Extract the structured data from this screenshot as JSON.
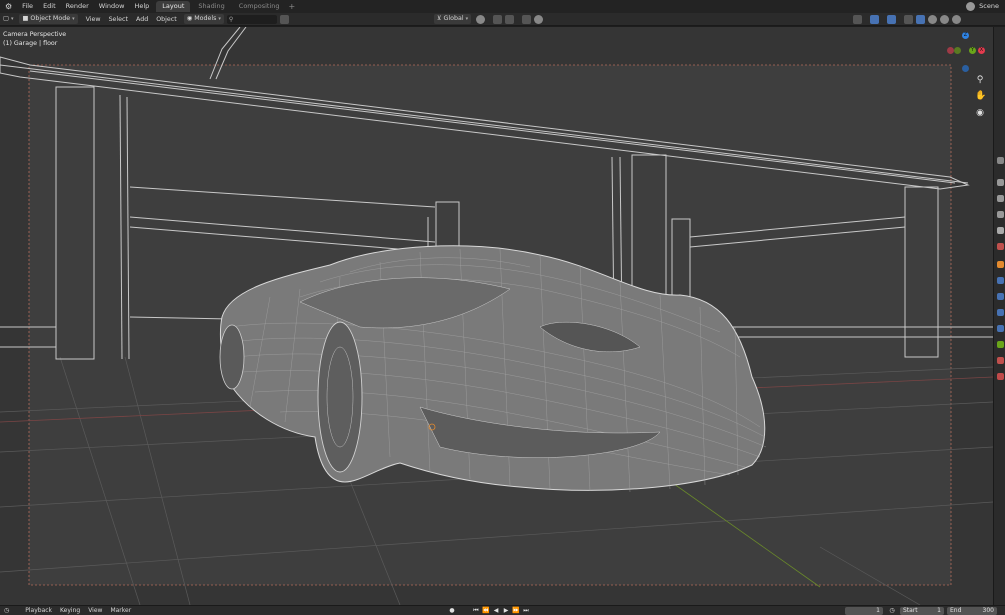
{
  "topbar": {
    "menus": [
      "File",
      "Edit",
      "Render",
      "Window",
      "Help"
    ],
    "workspace_tabs": [
      {
        "label": "Layout",
        "active": true
      },
      {
        "label": "Shading",
        "active": false
      },
      {
        "label": "Compositing",
        "active": false
      }
    ],
    "scene_label": "Scene"
  },
  "header": {
    "mode": "Object Mode",
    "menus": [
      "View",
      "Select",
      "Add",
      "Object"
    ],
    "collection": "Models",
    "search_placeholder": "",
    "transform_orientation": "Global"
  },
  "viewport": {
    "overlay_line1": "Camera Perspective",
    "overlay_line2": "(1) Garage | floor",
    "gizmo_axes": [
      {
        "label": "Z",
        "color": "#2f83e3"
      },
      {
        "label": "X",
        "color": "#e33b4e"
      },
      {
        "label": "Y",
        "color": "#6aa51a"
      }
    ]
  },
  "timeline": {
    "menus": [
      "Playback",
      "Keying",
      "View",
      "Marker"
    ],
    "current_frame": "1",
    "start_label": "Start",
    "start_value": "1",
    "end_label": "End",
    "end_value": "300"
  },
  "colors": {
    "viewport_bg": "#3c3c3c",
    "wire": "#d0d0d0",
    "accent_blue": "#4772b3",
    "x_axis": "#a54545",
    "y_axis": "#6a8a2a",
    "camera_frame": "#b36b5a"
  }
}
